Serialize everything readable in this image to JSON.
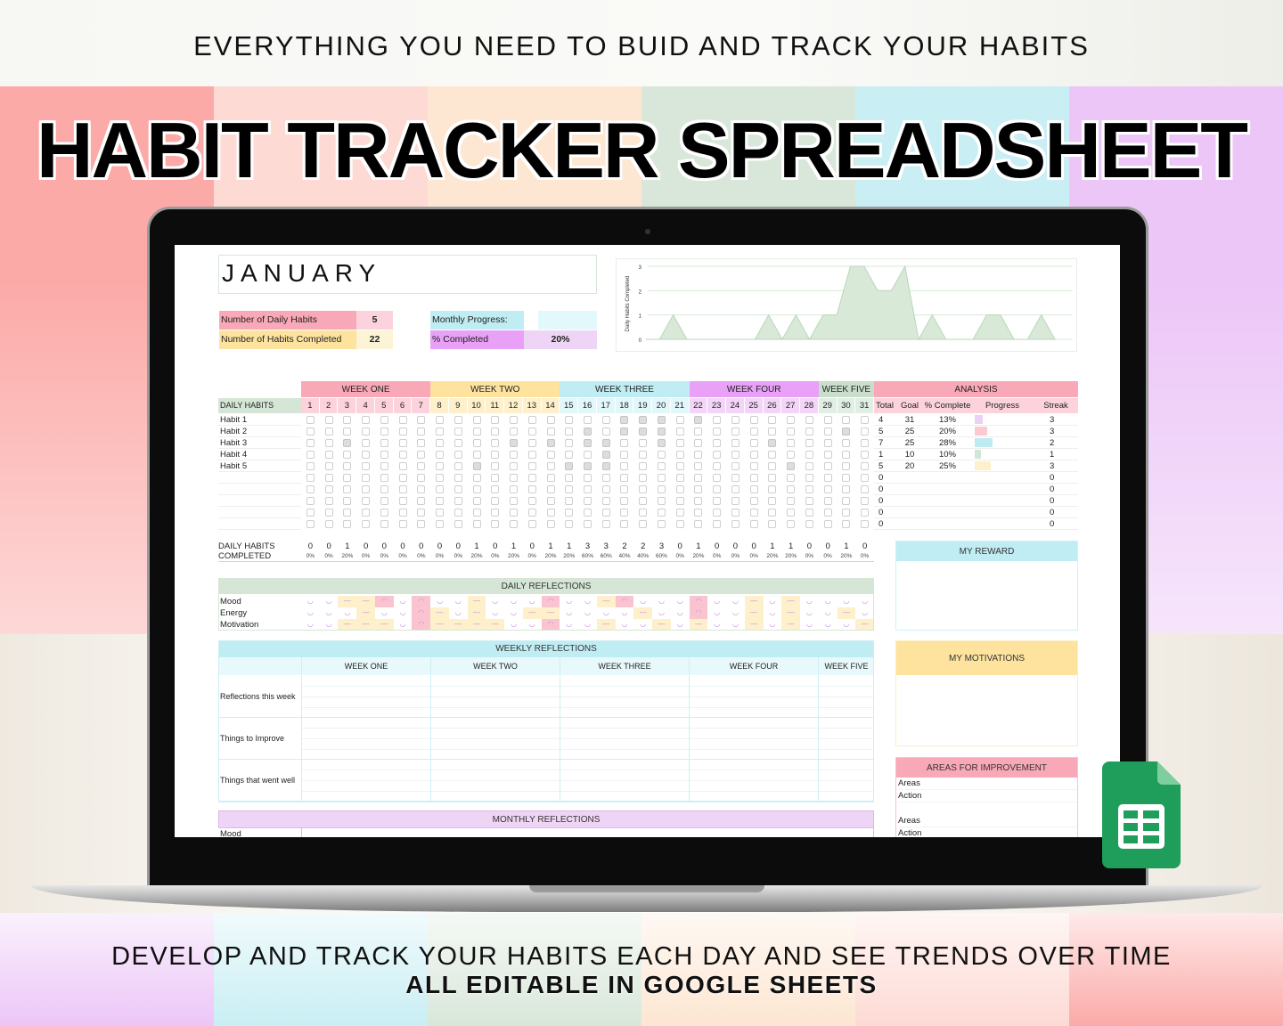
{
  "banner": {
    "tagline": "EVERYTHING YOU NEED TO BUID AND TRACK YOUR HABITS",
    "title": "HABIT TRACKER SPREADSHEET",
    "bottom_line1": "DEVELOP AND TRACK YOUR HABITS EACH DAY AND SEE TRENDS OVER TIME",
    "bottom_line2": "ALL EDITABLE IN GOOGLE SHEETS",
    "stripe_colors": [
      "#fbaaa8",
      "#fddad4",
      "#fde6d2",
      "#d9e7da",
      "#c9eef4",
      "#ecc6f7"
    ],
    "logo_icon": "google-sheets-icon"
  },
  "sheet": {
    "month": "JANUARY",
    "stats": {
      "daily_habits_label": "Number of Daily Habits",
      "daily_habits_value": "5",
      "completed_label": "Number of Habits Completed",
      "completed_value": "22",
      "monthly_progress_label": "Monthly Progress:",
      "monthly_progress": 0.2,
      "pct_label": "% Completed",
      "pct_value": "20%"
    },
    "chart_data": {
      "type": "area",
      "ylabel": "Daily Habits Completed",
      "x": [
        1,
        2,
        3,
        4,
        5,
        6,
        7,
        8,
        9,
        10,
        11,
        12,
        13,
        14,
        15,
        16,
        17,
        18,
        19,
        20,
        21,
        22,
        23,
        24,
        25,
        26,
        27,
        28,
        29,
        30,
        31
      ],
      "values": [
        0,
        0,
        1,
        0,
        0,
        0,
        0,
        0,
        0,
        1,
        0,
        1,
        0,
        1,
        1,
        3,
        3,
        2,
        2,
        3,
        0,
        1,
        0,
        0,
        0,
        1,
        1,
        0,
        0,
        1,
        0
      ],
      "ylim": [
        0,
        3
      ],
      "yticks": [
        "0",
        "1",
        "2",
        "3"
      ],
      "grid": true,
      "color": "#d8e9d8"
    },
    "weeks": [
      {
        "label": "WEEK ONE",
        "color": "#f9a8b8",
        "light": "#fcd3dc",
        "days": 7
      },
      {
        "label": "WEEK TWO",
        "color": "#fde39e",
        "light": "#fdf0cb",
        "days": 7
      },
      {
        "label": "WEEK THREE",
        "color": "#c0ecf3",
        "light": "#e1f7fa",
        "days": 7
      },
      {
        "label": "WEEK  FOUR",
        "color": "#e8a1f7",
        "light": "#f3d5f8",
        "days": 7
      },
      {
        "label": "WEEK FIVE",
        "color": "#c9dfcc",
        "light": "#e1eee3",
        "days": 3
      }
    ],
    "daily_habits_label": "DAILY HABITS",
    "analysis": {
      "label": "ANALYSIS",
      "columns": [
        "Total",
        "Goal",
        "% Complete",
        "Progress",
        "Streak"
      ]
    },
    "habits": [
      {
        "name": "Habit 1",
        "checked": [
          18,
          19,
          20,
          22
        ],
        "total": "4",
        "goal": "31",
        "pct": "13%",
        "progress": 0.13,
        "bar_color": "#ead2f7",
        "streak": "3"
      },
      {
        "name": "Habit 2",
        "checked": [
          16,
          18,
          19,
          20,
          30
        ],
        "total": "5",
        "goal": "25",
        "pct": "20%",
        "progress": 0.2,
        "bar_color": "#fcc9d3",
        "streak": "3"
      },
      {
        "name": "Habit 3",
        "checked": [
          3,
          12,
          14,
          16,
          17,
          20,
          26
        ],
        "total": "7",
        "goal": "25",
        "pct": "28%",
        "progress": 0.28,
        "bar_color": "#bfeaf2",
        "streak": "2"
      },
      {
        "name": "Habit 4",
        "checked": [
          17
        ],
        "total": "1",
        "goal": "10",
        "pct": "10%",
        "progress": 0.1,
        "bar_color": "#d3e6d6",
        "streak": "1"
      },
      {
        "name": "Habit 5",
        "checked": [
          10,
          15,
          16,
          17,
          27
        ],
        "total": "5",
        "goal": "20",
        "pct": "25%",
        "progress": 0.25,
        "bar_color": "#fdf0cb",
        "streak": "3"
      },
      {
        "name": "",
        "checked": [],
        "total": "0",
        "goal": "",
        "pct": "",
        "progress": 0,
        "bar_color": "",
        "streak": "0"
      },
      {
        "name": "",
        "checked": [],
        "total": "0",
        "goal": "",
        "pct": "",
        "progress": 0,
        "bar_color": "",
        "streak": "0"
      },
      {
        "name": "",
        "checked": [],
        "total": "0",
        "goal": "",
        "pct": "",
        "progress": 0,
        "bar_color": "",
        "streak": "0"
      },
      {
        "name": "",
        "checked": [],
        "total": "0",
        "goal": "",
        "pct": "",
        "progress": 0,
        "bar_color": "",
        "streak": "0"
      },
      {
        "name": "",
        "checked": [],
        "total": "0",
        "goal": "",
        "pct": "",
        "progress": 0,
        "bar_color": "",
        "streak": "0"
      }
    ],
    "completed_label_1": "DAILY HABITS",
    "completed_label_2": "COMPLETED",
    "daily_completed": [
      "0",
      "0",
      "1",
      "0",
      "0",
      "0",
      "0",
      "0",
      "0",
      "1",
      "0",
      "1",
      "0",
      "1",
      "1",
      "3",
      "3",
      "2",
      "2",
      "3",
      "0",
      "1",
      "0",
      "0",
      "0",
      "1",
      "1",
      "0",
      "0",
      "1",
      "0"
    ],
    "daily_pct": [
      "0%",
      "0%",
      "20%",
      "0%",
      "0%",
      "0%",
      "0%",
      "0%",
      "0%",
      "20%",
      "0%",
      "20%",
      "0%",
      "20%",
      "20%",
      "60%",
      "60%",
      "40%",
      "40%",
      "60%",
      "0%",
      "20%",
      "0%",
      "0%",
      "0%",
      "20%",
      "20%",
      "0%",
      "0%",
      "20%",
      "0%"
    ],
    "daily_reflections": {
      "label": "DAILY REFLECTIONS",
      "rows": [
        {
          "name": "Mood",
          "states": [
            "happy",
            "happy",
            "neutral",
            "neutral",
            "sad",
            "happy",
            "sad",
            "happy",
            "happy",
            "neutral",
            "happy",
            "happy",
            "happy",
            "sad",
            "happy",
            "happy",
            "neutral",
            "sad",
            "happy",
            "happy",
            "happy",
            "sad",
            "happy",
            "happy",
            "neutral",
            "happy",
            "neutral",
            "happy",
            "happy",
            "happy",
            "happy"
          ]
        },
        {
          "name": "Energy",
          "states": [
            "happy",
            "happy",
            "happy",
            "neutral",
            "happy",
            "happy",
            "sad",
            "neutral",
            "happy",
            "neutral",
            "happy",
            "happy",
            "neutral",
            "neutral",
            "happy",
            "happy",
            "happy",
            "happy",
            "neutral",
            "happy",
            "happy",
            "sad",
            "happy",
            "happy",
            "neutral",
            "happy",
            "neutral",
            "happy",
            "happy",
            "neutral",
            "happy"
          ]
        },
        {
          "name": "Motivation",
          "states": [
            "happy",
            "happy",
            "neutral",
            "neutral",
            "neutral",
            "happy",
            "sad",
            "neutral",
            "neutral",
            "neutral",
            "neutral",
            "happy",
            "happy",
            "sad",
            "happy",
            "happy",
            "neutral",
            "happy",
            "happy",
            "neutral",
            "happy",
            "neutral",
            "happy",
            "happy",
            "neutral",
            "happy",
            "neutral",
            "happy",
            "happy",
            "happy",
            "neutral"
          ]
        }
      ],
      "state_colors": {
        "happy": "#ffffff",
        "neutral": "#fdf0cb",
        "sad": "#f9c4d0"
      }
    },
    "weekly_reflections": {
      "label": "WEEKLY REFLECTIONS",
      "columns": [
        "WEEK ONE",
        "WEEK TWO",
        "WEEK THREE",
        "WEEK FOUR",
        "WEEK FIVE"
      ],
      "rows": [
        "Reflections this week",
        "Things to Improve",
        "Things that went well"
      ]
    },
    "monthly_reflections": {
      "label": "MONTHLY REFLECTIONS",
      "rows": [
        "Mood"
      ]
    },
    "my_reward": "MY REWARD",
    "my_motivations": "MY MOTIVATIONS",
    "areas": {
      "label": "AREAS FOR IMPROVEMENT",
      "rows": [
        "Areas",
        "Action",
        "Areas",
        "Action"
      ]
    }
  }
}
